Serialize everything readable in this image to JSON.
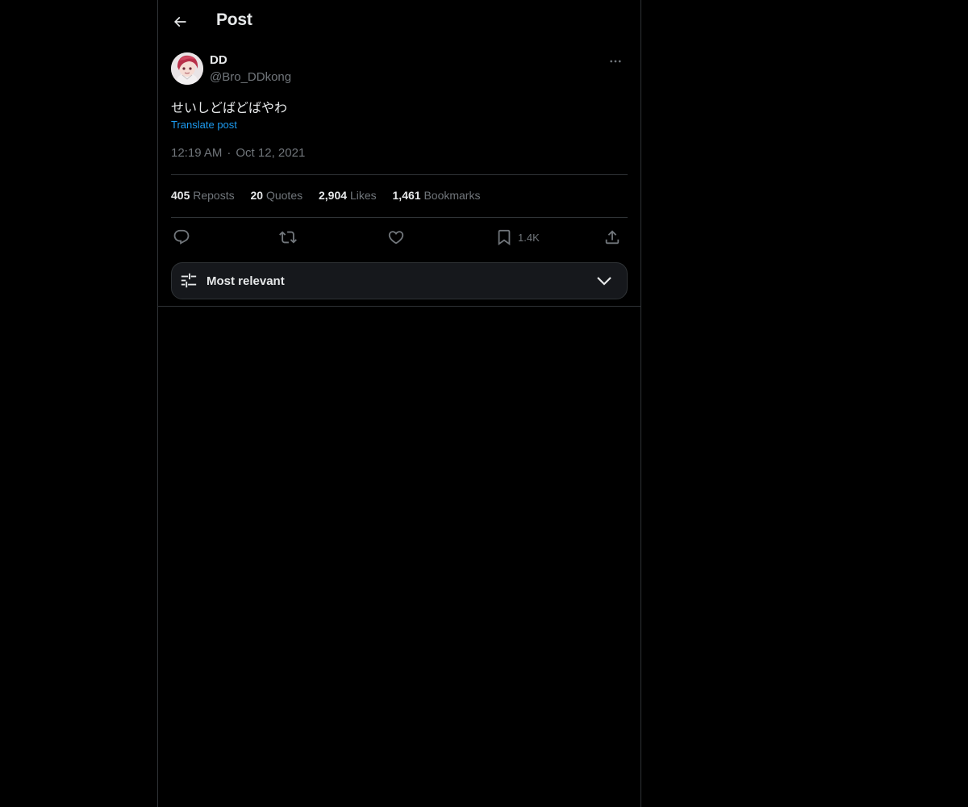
{
  "header": {
    "title": "Post"
  },
  "author": {
    "display_name": "DD",
    "handle": "@Bro_DDkong"
  },
  "post": {
    "text": "せいしどばどばやわ",
    "translate_label": "Translate post",
    "time": "12:19 AM",
    "separator": "·",
    "date": "Oct 12, 2021"
  },
  "stats": {
    "reposts": {
      "count": "405",
      "label": "Reposts"
    },
    "quotes": {
      "count": "20",
      "label": "Quotes"
    },
    "likes": {
      "count": "2,904",
      "label": "Likes"
    },
    "bookmarks": {
      "count": "1,461",
      "label": "Bookmarks"
    }
  },
  "actions": {
    "reply_icon": "reply-icon",
    "repost_icon": "repost-icon",
    "like_icon": "heart-icon",
    "bookmark_icon": "bookmark-icon",
    "bookmark_count": "1.4K",
    "share_icon": "share-icon"
  },
  "sort": {
    "label": "Most relevant"
  },
  "colors": {
    "background": "#000000",
    "text_primary": "#e7e9ea",
    "text_secondary": "#71767b",
    "link": "#1d9bf0",
    "border": "#2f3336"
  }
}
